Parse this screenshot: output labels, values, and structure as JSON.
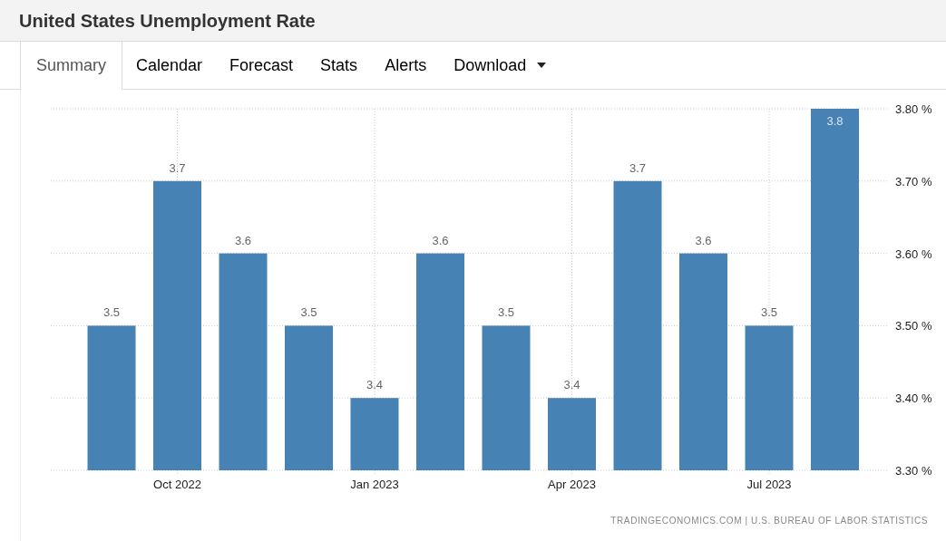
{
  "title": "United States Unemployment Rate",
  "tabs": [
    {
      "label": "Summary",
      "selected": true
    },
    {
      "label": "Calendar",
      "selected": false
    },
    {
      "label": "Forecast",
      "selected": false
    },
    {
      "label": "Stats",
      "selected": false
    },
    {
      "label": "Alerts",
      "selected": false
    },
    {
      "label": "Download",
      "selected": false,
      "dropdown": true
    }
  ],
  "chart": {
    "chart_data": {
      "type": "bar",
      "categories": [
        null,
        "Oct 2022",
        null,
        null,
        "Jan 2023",
        null,
        null,
        "Apr 2023",
        null,
        null,
        "Jul 2023",
        null
      ],
      "series": [
        {
          "color": "#4682b4",
          "values": [
            3.5,
            3.7,
            3.6,
            3.5,
            3.4,
            3.6,
            3.5,
            3.4,
            3.7,
            3.6,
            3.5,
            3.8
          ]
        }
      ],
      "grid": true,
      "ylim": [
        3.3,
        3.8
      ],
      "yticks": [
        {
          "value": 3.8,
          "label": "3.80 %"
        },
        {
          "value": 3.7,
          "label": "3.70 %"
        },
        {
          "value": 3.6,
          "label": "3.60 %"
        },
        {
          "value": 3.5,
          "label": "3.50 %"
        },
        {
          "value": 3.4,
          "label": "3.40 %"
        },
        {
          "value": 3.3,
          "label": "3.30 %"
        }
      ],
      "value_labels": [
        "3.5",
        "3.7",
        "3.6",
        "3.5",
        "3.4",
        "3.6",
        "3.5",
        "3.4",
        "3.7",
        "3.6",
        "3.5",
        "3.8"
      ]
    },
    "source": "TRADINGECONOMICS.COM | U.S. BUREAU OF LABOR STATISTICS"
  }
}
